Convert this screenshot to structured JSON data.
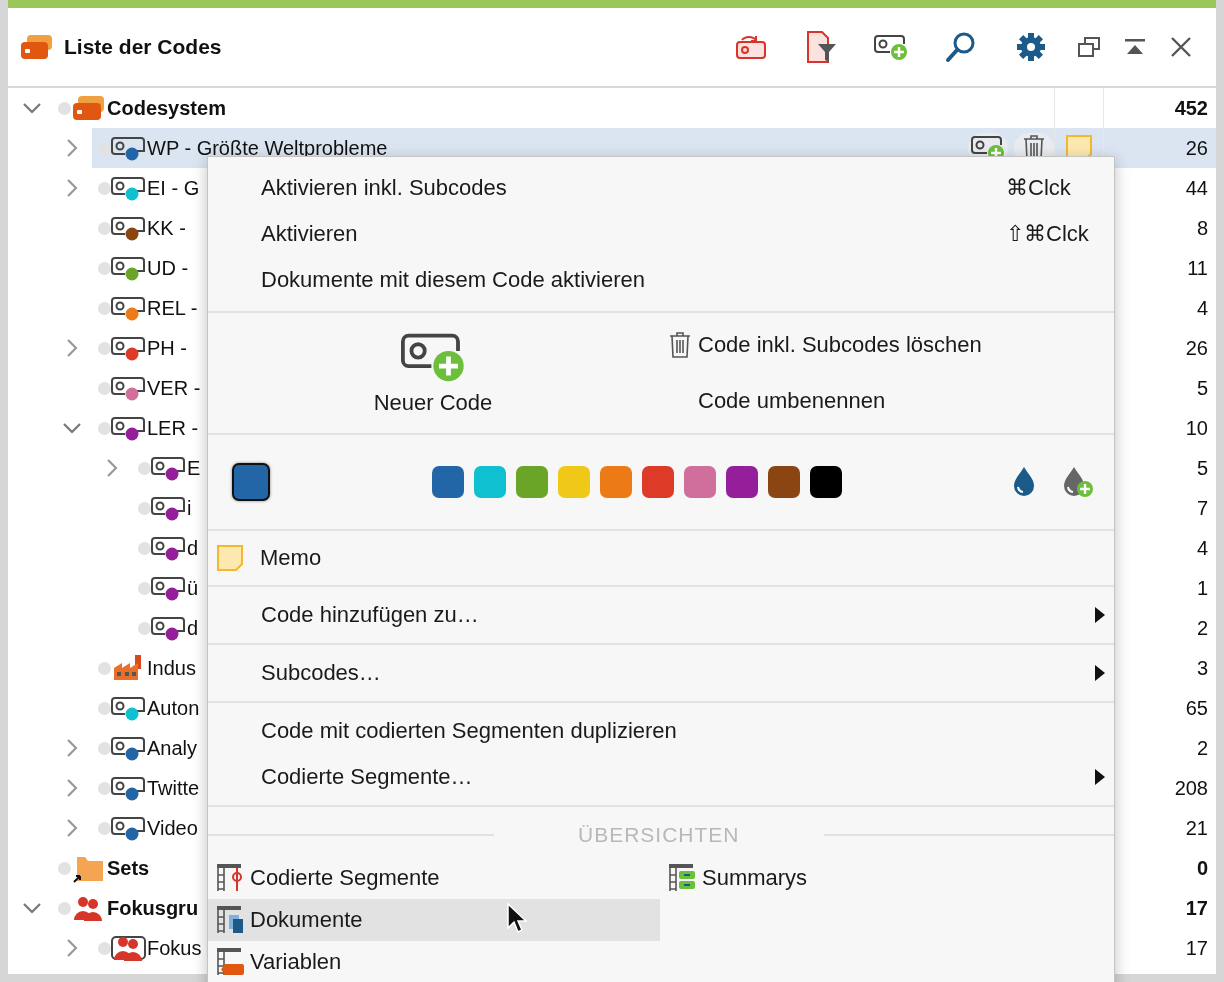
{
  "window": {
    "title": "Liste der Codes"
  },
  "tree": [
    {
      "label": "Codesystem",
      "kind": "codesystem",
      "count": "452",
      "expanded": true,
      "selected": false,
      "children": [
        {
          "label": "WP - Größte Weltprobleme",
          "kind": "code",
          "color": "#2366a8",
          "count": "26",
          "expanded": false,
          "selected": true
        },
        {
          "label": "EI - G",
          "kind": "code",
          "color": "#0fc0d0",
          "count": "44",
          "expanded": false,
          "selected": false
        },
        {
          "label": "KK -",
          "kind": "code",
          "color": "#8b4513",
          "count": "8",
          "selected": false
        },
        {
          "label": "UD -",
          "kind": "code",
          "color": "#6aa528",
          "count": "11",
          "selected": false
        },
        {
          "label": "REL -",
          "kind": "code",
          "color": "#ec7a16",
          "count": "4",
          "selected": false
        },
        {
          "label": "PH -",
          "kind": "code",
          "color": "#dd3b28",
          "count": "26",
          "expanded": false,
          "selected": false
        },
        {
          "label": "VER -",
          "kind": "code",
          "color": "#d06f9b",
          "count": "5",
          "selected": false
        },
        {
          "label": "LER -",
          "kind": "code",
          "color": "#951f9b",
          "count": "10",
          "expanded": true,
          "selected": false,
          "children": [
            {
              "label": "E",
              "kind": "code",
              "color": "#951f9b",
              "count": "5",
              "expanded": false,
              "selected": false
            },
            {
              "label": "i",
              "kind": "code",
              "color": "#951f9b",
              "count": "7",
              "selected": false
            },
            {
              "label": "d",
              "kind": "code",
              "color": "#951f9b",
              "count": "4",
              "selected": false
            },
            {
              "label": "ü",
              "kind": "code",
              "color": "#951f9b",
              "count": "1",
              "selected": false
            },
            {
              "label": "d",
              "kind": "code",
              "color": "#951f9b",
              "count": "2",
              "selected": false
            }
          ]
        },
        {
          "label": "Indus",
          "kind": "factory",
          "count": "3",
          "selected": false
        },
        {
          "label": "Auton",
          "kind": "code",
          "color": "#0fc0d0",
          "count": "65",
          "selected": false
        },
        {
          "label": "Analy",
          "kind": "code",
          "color": "#2366a8",
          "count": "2",
          "expanded": false,
          "selected": false
        },
        {
          "label": "Twitte",
          "kind": "code",
          "color": "#2366a8",
          "count": "208",
          "expanded": false,
          "selected": false
        },
        {
          "label": "Video",
          "kind": "code",
          "color": "#2366a8",
          "count": "21",
          "expanded": false,
          "selected": false
        }
      ]
    },
    {
      "label": "Sets",
      "kind": "sets",
      "count": "0",
      "selected": false
    },
    {
      "label": "Fokusgru",
      "kind": "group",
      "count": "17",
      "expanded": true,
      "selected": false,
      "children": [
        {
          "label": "Fokus",
          "kind": "group-item",
          "count": "17",
          "expanded": false,
          "selected": false
        }
      ]
    }
  ],
  "menu": {
    "top_items": [
      {
        "label": "Aktivieren inkl. Subcodes",
        "shortcut": "⌘Clck"
      },
      {
        "label": "Aktivieren",
        "shortcut": "⇧⌘Clck"
      },
      {
        "label": "Dokumente mit diesem Code aktivieren"
      }
    ],
    "new_code": "Neuer Code",
    "side_actions": [
      {
        "label": "Code inkl. Subcodes löschen",
        "kind": "delete"
      },
      {
        "label": "Code umbenennen",
        "kind": "rename"
      }
    ],
    "current": {
      "color": "#2366a8"
    },
    "palette": [
      {
        "color": "#2366a8"
      },
      {
        "color": "#0fc0d0"
      },
      {
        "color": "#6aa528"
      },
      {
        "color": "#f0c818"
      },
      {
        "color": "#ec7a16"
      },
      {
        "color": "#dd3b28"
      },
      {
        "color": "#d06f9b"
      },
      {
        "color": "#951f9b"
      },
      {
        "color": "#8b4513"
      },
      {
        "color": "#000000"
      }
    ],
    "memo": "Memo",
    "groups": [
      [
        {
          "label": "Code hinzufügen zu…",
          "submenu": true
        }
      ],
      [
        {
          "label": "Subcodes…",
          "submenu": true
        }
      ],
      [
        {
          "label": "Code mit codierten Segmenten duplizieren",
          "submenu": false
        },
        {
          "label": "Codierte Segmente…",
          "submenu": true
        }
      ]
    ],
    "overviews": {
      "title": "ÜBERSICHTEN",
      "items": [
        {
          "label": "Codierte Segmente",
          "kind": "segments",
          "selected": false
        },
        {
          "label": "Summarys",
          "kind": "summaries",
          "selected": false
        },
        {
          "label": "Dokumente",
          "kind": "documents",
          "selected": true
        },
        {
          "label": "Variablen",
          "kind": "variables",
          "selected": false
        }
      ]
    }
  }
}
